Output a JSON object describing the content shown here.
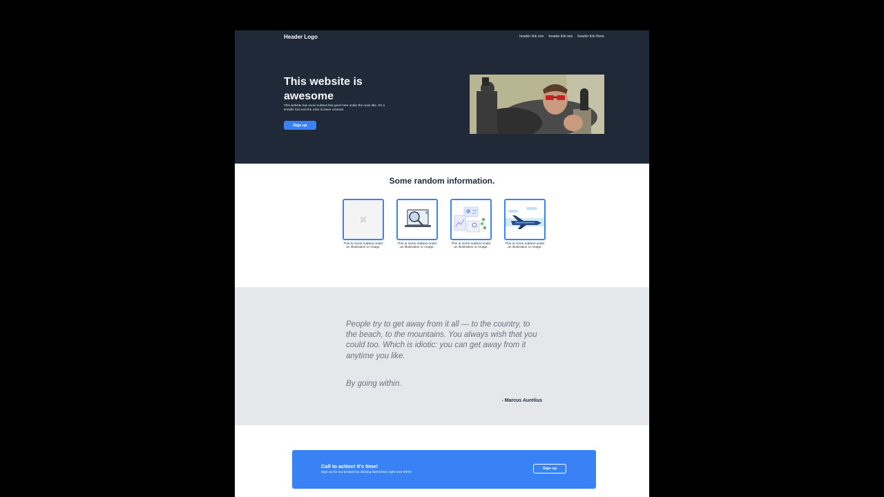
{
  "header": {
    "logo": "Header Logo",
    "links": [
      "header link one",
      "header link two",
      "header link three"
    ]
  },
  "hero": {
    "title": "This website is awesome",
    "subtitle": "This website has some subtext that goes here under the main title. It's a smaller font and the color is lower contrast.",
    "button_label": "Sign up"
  },
  "info": {
    "title": "Some random information.",
    "cards": [
      {
        "text": "This is some subtext under an illustration or image.",
        "icon": "broken-image-icon"
      },
      {
        "text": "This is some subtext under an illustration or image.",
        "icon": "laptop-magnifier-illustration"
      },
      {
        "text": "This is some subtext under an illustration or image.",
        "icon": "dashboard-illustration"
      },
      {
        "text": "This is some subtext under an illustration or image.",
        "icon": "airplane-illustration"
      }
    ]
  },
  "quote": {
    "text": "People try to get away from it all — to the country, to the beach, to the mountains. You always wish that you could too. Which is idiotic: you can get away from it anytime you like.",
    "text2": "By going within.",
    "author": "- Marcus Aurelius"
  },
  "cta": {
    "title": "Call to action! It's time!",
    "subtitle": "Sign up for our product by clicking that button right over there!",
    "button_label": "Sign up"
  },
  "colors": {
    "hero_bg": "#1f2937",
    "accent": "#3882f6",
    "quote_bg": "#e5e7eb"
  }
}
